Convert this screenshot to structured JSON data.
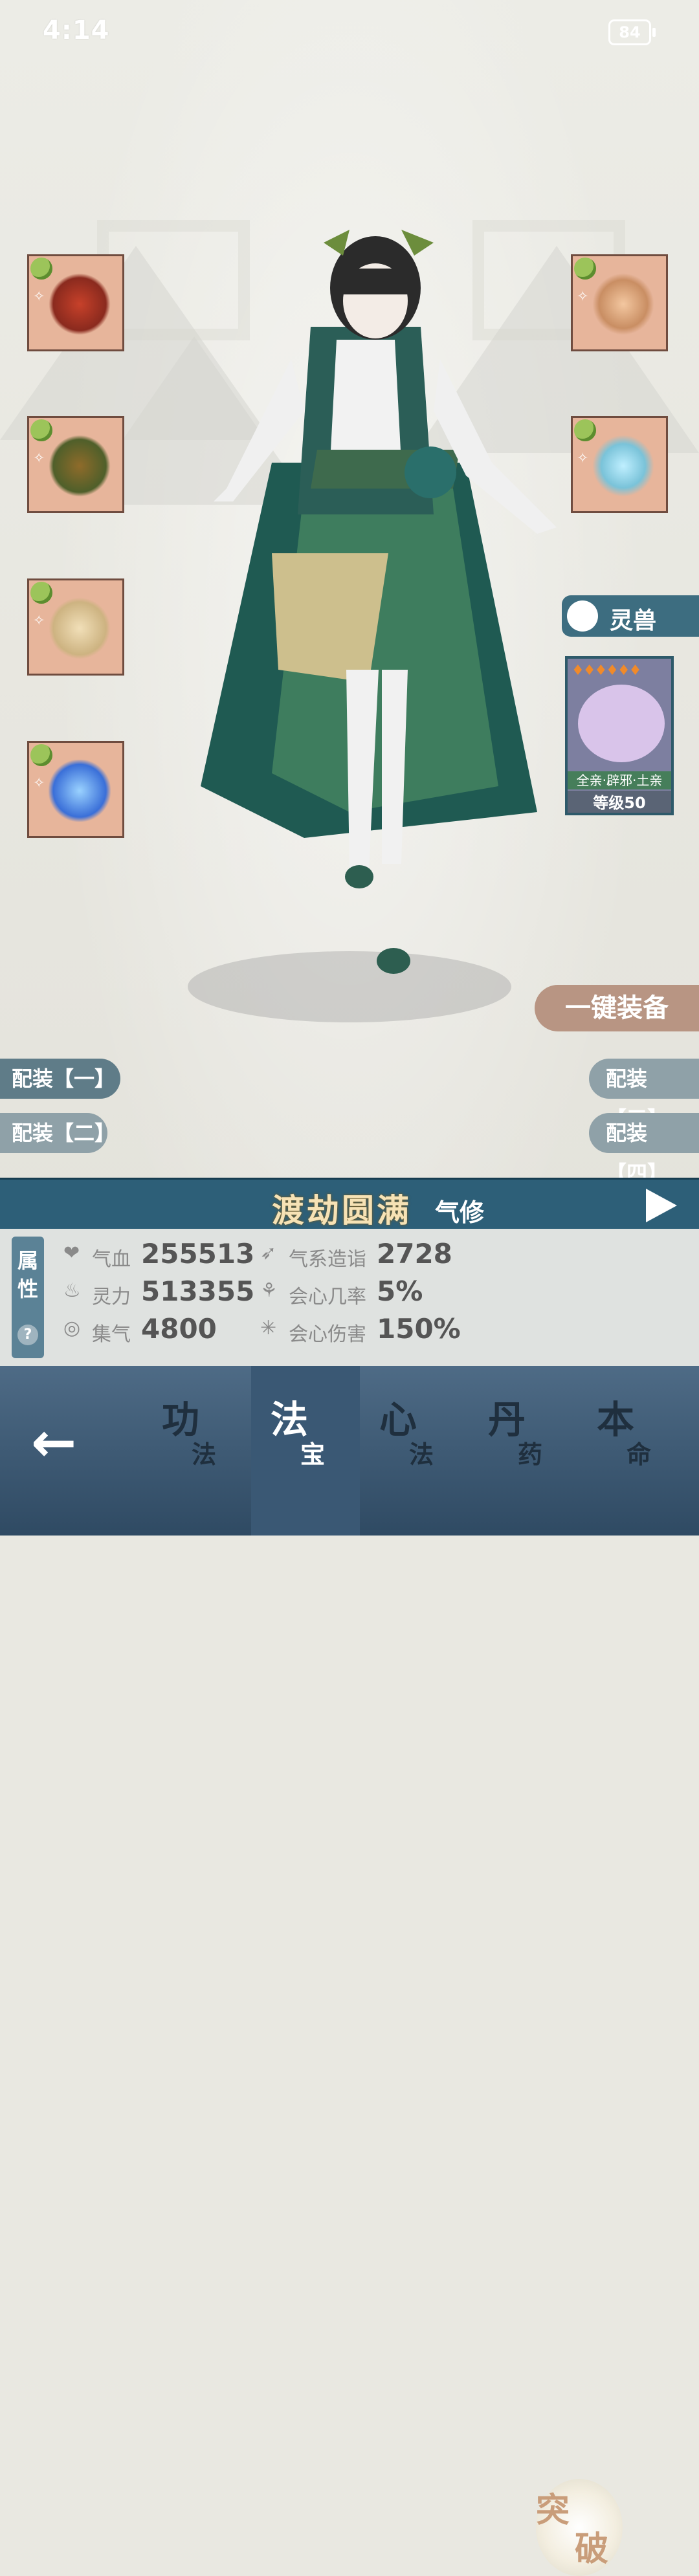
{
  "status": {
    "time": "4:14",
    "battery": "84"
  },
  "equipment": {
    "left": [
      {
        "name": "crimson-fan-weapon",
        "gem_color": "#b4d35c"
      },
      {
        "name": "lotus-crown-treasure",
        "gem_color": "#d4dd4a"
      },
      {
        "name": "golden-boots",
        "gem_color": "#a3d25c"
      },
      {
        "name": "blue-vortex-orb",
        "gem_color": "#b3d95b"
      }
    ],
    "right": [
      {
        "name": "bronze-bell-treasure",
        "gem_color": "#a3d25c"
      },
      {
        "name": "crystal-mirror-treasure",
        "gem_color": "#b4d35c"
      }
    ]
  },
  "spirit_beast": {
    "tab_label": "灵兽",
    "stars": 6,
    "elements": "全亲·辟邪·土亲",
    "level": "等级50"
  },
  "actions": {
    "equip_all": "一键装备"
  },
  "presets": [
    "配装【一】",
    "配装【二】",
    "配装【三】",
    "配装【四】"
  ],
  "realm": {
    "name": "渡劫圆满",
    "type": "气修"
  },
  "attributes": {
    "tag": [
      "属",
      "性"
    ],
    "help": "?",
    "stats": [
      {
        "label": "气血",
        "value": "255513"
      },
      {
        "label": "灵力",
        "value": "513355"
      },
      {
        "label": "集气",
        "value": "4800"
      },
      {
        "label": "气系造诣",
        "value": "2728"
      },
      {
        "label": "会心几率",
        "value": "5%"
      },
      {
        "label": "会心伤害",
        "value": "150%"
      }
    ],
    "breakthrough": [
      "突",
      "破"
    ]
  },
  "nav": {
    "tabs": [
      {
        "big": "功",
        "small": "法",
        "active": false
      },
      {
        "big": "法",
        "small": "宝",
        "active": true
      },
      {
        "big": "心",
        "small": "法",
        "active": false
      },
      {
        "big": "丹",
        "small": "药",
        "active": false
      },
      {
        "big": "本",
        "small": "命",
        "active": false
      }
    ]
  }
}
